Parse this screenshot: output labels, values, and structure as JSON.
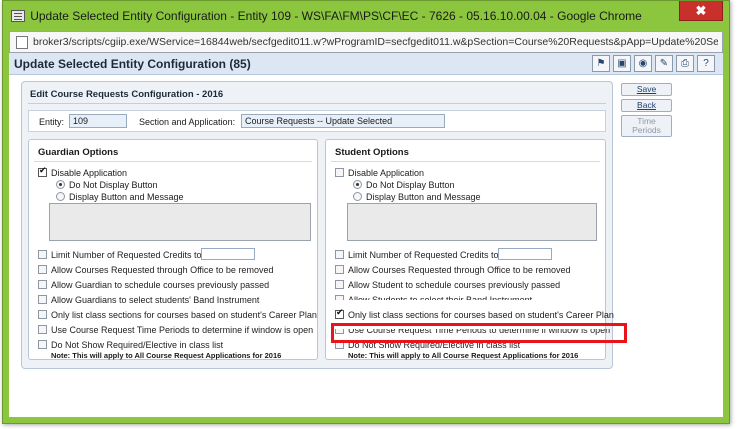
{
  "window": {
    "title": "Update Selected Entity Configuration - Entity 109 - WS\\FA\\FM\\PS\\CF\\EC - 7626 - 05.16.10.00.04 - Google Chrome",
    "close_label": "✖",
    "url": "broker3/scripts/cgiip.exe/WService=16844web/secfgedit011.w?wProgramID=secfgedit011.w&pSection=Course%20Requests&pApp=Update%20Se"
  },
  "page": {
    "title": "Update Selected Entity Configuration (85)",
    "tools": [
      "flag-icon",
      "monitor-icon",
      "camera-icon",
      "note-icon",
      "print-icon",
      "help-icon"
    ],
    "help_label": "?"
  },
  "section": {
    "title": "Edit Course Requests Configuration - 2016",
    "entity_label": "Entity:",
    "entity_value": "109",
    "section_app_label": "Section and Application:",
    "section_app_value": "Course Requests -- Update Selected"
  },
  "guardian": {
    "title": "Guardian Options",
    "disable_label": "Disable Application",
    "radio1": "Do Not Display Button",
    "radio2": "Display Button and Message",
    "opt1": "Limit Number of Requested Credits to",
    "opt2": "Allow Courses Requested through Office to be removed",
    "opt3": "Allow Guardian to schedule courses previously passed",
    "opt4": "Allow Guardians to select students' Band Instrument",
    "opt5": "Only list class sections for courses based on student's Career Plan",
    "opt6": "Use Course Request Time Periods to determine if window is open",
    "opt7": "Do Not Show Required/Elective in class list",
    "note": "Note: This will apply to All Course Request Applications for 2016"
  },
  "student": {
    "title": "Student Options",
    "disable_label": "Disable Application",
    "radio1": "Do Not Display Button",
    "radio2": "Display Button and Message",
    "opt1": "Limit Number of Requested Credits to",
    "opt2": "Allow Courses Requested through Office to be removed",
    "opt3": "Allow Student to schedule courses previously passed",
    "opt4": "Allow Students to select their Band Instrument",
    "opt5": "Only list class sections for courses based on student's Career Plan",
    "opt6": "Use Course Request Time Periods to determine if window is open",
    "opt7": "Do Not Show Required/Elective in class list",
    "note": "Note: This will apply to All Course Request Applications for 2016"
  },
  "buttons": {
    "save": "Save",
    "back": "Back",
    "time_periods_line1": "Time",
    "time_periods_line2": "Periods"
  },
  "colors": {
    "window_frame": "#8cc63f",
    "highlight": "#e8141a"
  }
}
